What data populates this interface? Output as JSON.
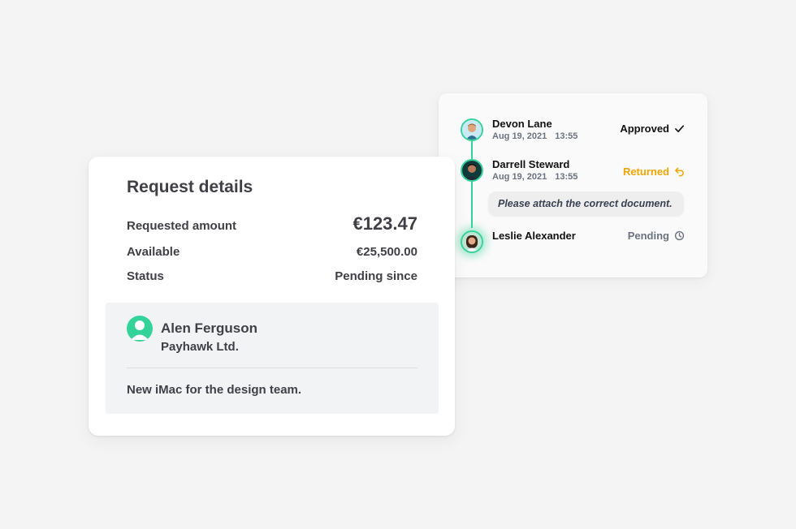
{
  "approval_flow": {
    "steps": [
      {
        "name": "Devon Lane",
        "date": "Aug 19, 2021",
        "time": "13:55",
        "status": "Approved",
        "status_icon": "check-icon"
      },
      {
        "name": "Darrell Steward",
        "date": "Aug 19, 2021",
        "time": "13:55",
        "status": "Returned",
        "status_icon": "return-arrow-icon"
      },
      {
        "name": "Leslie Alexander",
        "status": "Pending",
        "status_icon": "clock-icon"
      }
    ],
    "comment": "Please attach the correct document."
  },
  "request": {
    "title": "Request details",
    "requested_amount_label": "Requested amount",
    "requested_amount_value": "€123.47",
    "available_label": "Available",
    "available_value": "€25,500.00",
    "status_label": "Status",
    "status_value": "Pending since",
    "requester": {
      "name": "Alen Ferguson",
      "company": "Payhawk Ltd.",
      "note": "New iMac for the design team."
    }
  },
  "colors": {
    "accent_green": "#34d399",
    "returned_orange": "#f0a500",
    "pending_gray": "#6b7280",
    "page_background": "#f4f4f5"
  }
}
